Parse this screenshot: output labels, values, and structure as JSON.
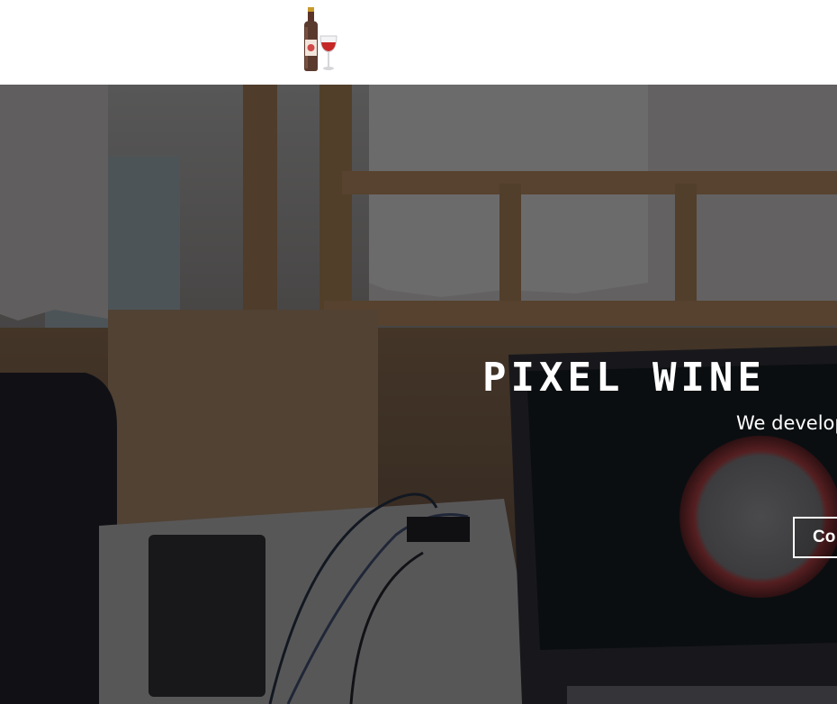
{
  "header": {
    "logo_icon": "wine-bottle-and-glass-icon"
  },
  "hero": {
    "title": "PIXEL WINE",
    "subtitle": "We develop",
    "cta_label": "Co"
  },
  "colors": {
    "header_bg": "#ffffff",
    "hero_overlay": "rgba(10,10,12,0.55)",
    "hero_text": "#ffffff"
  }
}
